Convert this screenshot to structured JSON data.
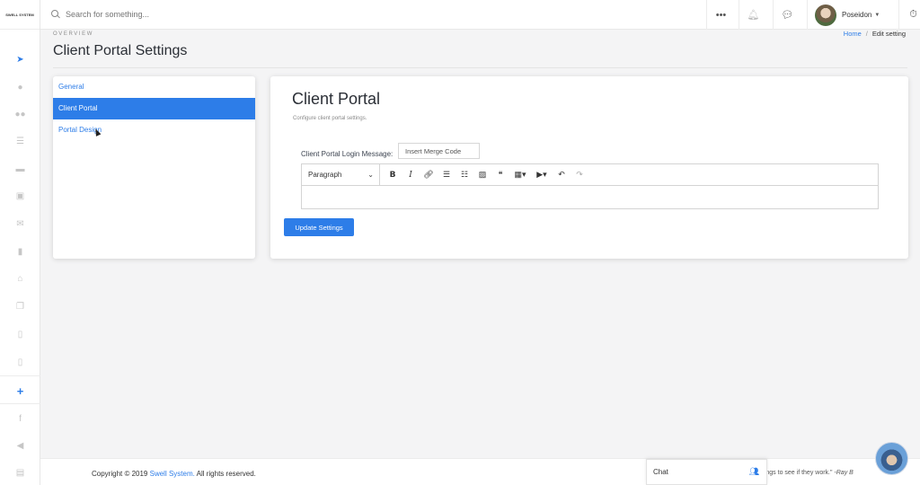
{
  "rail": {
    "logo": "SWELL SYSTEM",
    "icons": [
      "send-icon",
      "user-icon",
      "users-icon",
      "list-icon",
      "folder-icon",
      "calendar-check-icon",
      "mail-icon",
      "trash-icon",
      "sitemap-icon",
      "copy-icon",
      "file-icon",
      "document-icon"
    ],
    "extra_icons": [
      "facebook-icon",
      "megaphone-icon",
      "archive-icon"
    ],
    "plus": "+"
  },
  "topbar": {
    "search_placeholder": "Search for something...",
    "user_name": "Poseidon"
  },
  "header": {
    "overview": "OVERVIEW",
    "title": "Client Portal Settings",
    "breadcrumb": {
      "home": "Home",
      "separator": "/",
      "current": "Edit setting"
    }
  },
  "menu": {
    "items": [
      {
        "label": "General",
        "active": false
      },
      {
        "label": "Client Portal",
        "active": true
      },
      {
        "label": "Portal Design",
        "active": false
      }
    ]
  },
  "card": {
    "title": "Client Portal",
    "subtitle": "Configure client portal settings.",
    "field_label": "Client Portal Login Message:",
    "merge_button": "Insert Merge Code",
    "editor": {
      "block_format": "Paragraph",
      "tools": [
        "bold-icon",
        "italic-icon",
        "link-icon",
        "bullet-list-icon",
        "numbered-list-icon",
        "image-icon",
        "quote-icon",
        "table-icon",
        "media-icon",
        "undo-icon",
        "redo-icon"
      ]
    },
    "submit": "Update Settings"
  },
  "footer": {
    "copyright_prefix": "Copyright © 2019 ",
    "brand": "Swell System.",
    "copyright_suffix": " All rights reserved.",
    "quote": "things to see if they work.\" ",
    "quote_author": "-Ray B"
  },
  "chat": {
    "label": "Chat"
  },
  "colors": {
    "accent": "#2d7de8",
    "background": "#f4f4f5"
  }
}
